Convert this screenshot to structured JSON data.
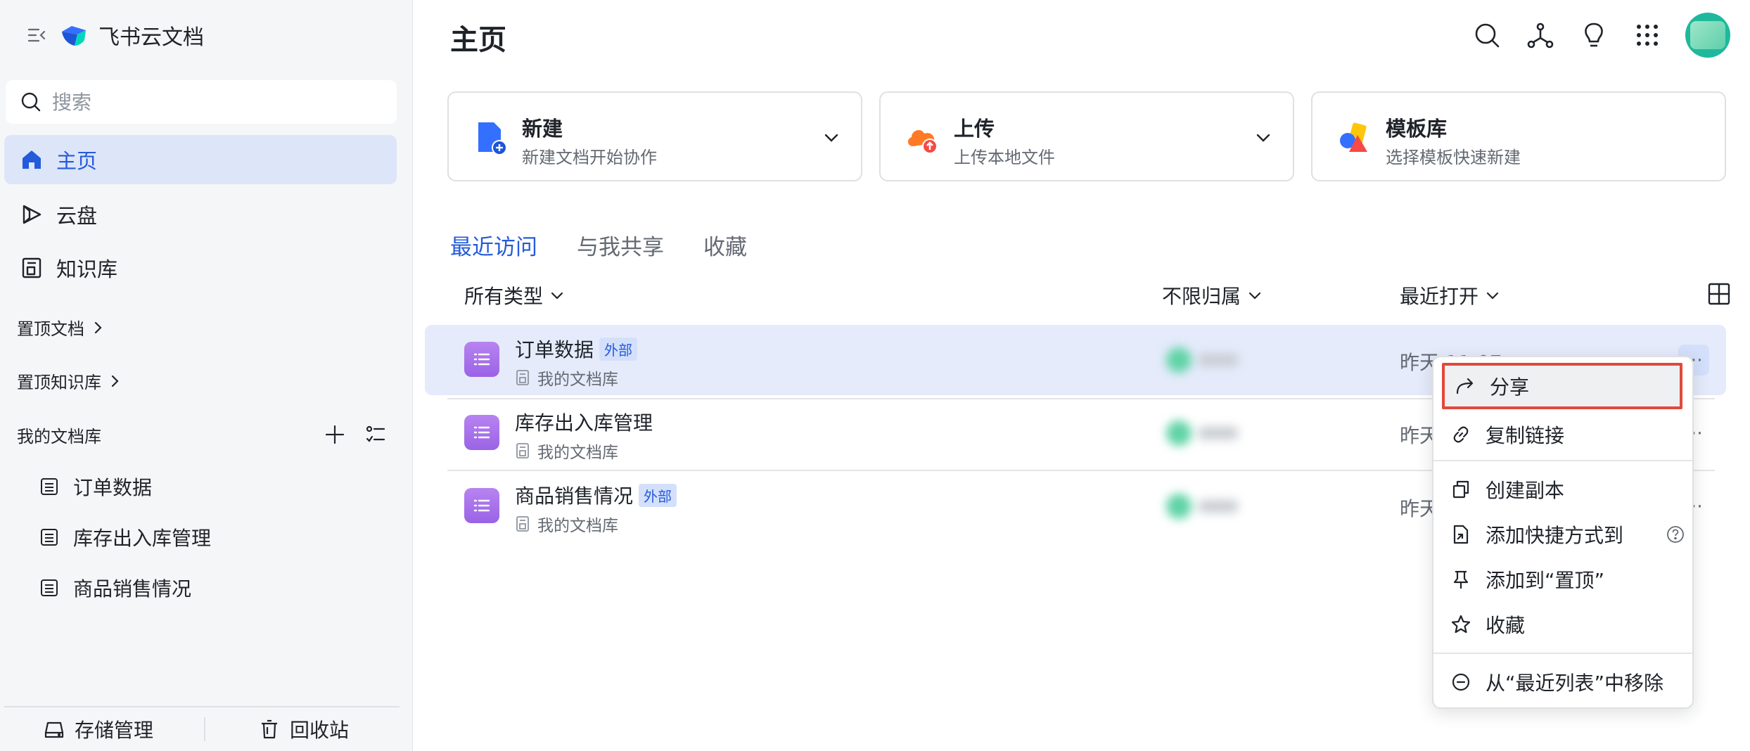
{
  "app": {
    "name": "飞书云文档"
  },
  "search": {
    "placeholder": "搜索"
  },
  "sidebar": {
    "nav": [
      {
        "label": "主页",
        "icon": "home-icon",
        "active": true
      },
      {
        "label": "云盘",
        "icon": "cloud-drive-icon",
        "active": false
      },
      {
        "label": "知识库",
        "icon": "wiki-icon",
        "active": false
      }
    ],
    "pinned_docs": "置顶文档",
    "pinned_wikis": "置顶知识库",
    "my_library": {
      "title": "我的文档库",
      "items": [
        "订单数据",
        "库存出入库管理",
        "商品销售情况"
      ]
    },
    "footer": {
      "storage": "存储管理",
      "trash": "回收站"
    }
  },
  "main": {
    "title": "主页",
    "cards": [
      {
        "title": "新建",
        "subtitle": "新建文档开始协作",
        "icon": "new-doc-icon"
      },
      {
        "title": "上传",
        "subtitle": "上传本地文件",
        "icon": "upload-cloud-icon"
      },
      {
        "title": "模板库",
        "subtitle": "选择模板快速新建",
        "icon": "template-library-icon"
      }
    ],
    "tabs": [
      "最近访问",
      "与我共享",
      "收藏"
    ],
    "active_tab": "最近访问",
    "filters": {
      "type": "所有类型",
      "owner": "不限归属",
      "sort": "最近打开"
    },
    "rows": [
      {
        "name": "订单数据",
        "badge": "外部",
        "library": "我的文档库",
        "time": "昨天 11:07"
      },
      {
        "name": "库存出入库管理",
        "badge": "",
        "library": "我的文档库",
        "time": "昨天"
      },
      {
        "name": "商品销售情况",
        "badge": "外部",
        "library": "我的文档库",
        "time": "昨天"
      }
    ]
  },
  "context_menu": {
    "items": [
      {
        "label": "分享",
        "icon": "share-icon"
      },
      {
        "label": "复制链接",
        "icon": "link-icon"
      },
      {
        "label": "创建副本",
        "icon": "copy-icon"
      },
      {
        "label": "添加快捷方式到",
        "icon": "shortcut-icon"
      },
      {
        "label": "添加到“置顶”",
        "icon": "pin-icon"
      },
      {
        "label": "收藏",
        "icon": "star-icon"
      },
      {
        "label": "从“最近列表”中移除",
        "icon": "remove-icon"
      }
    ],
    "highlighted": "分享"
  },
  "colors": {
    "accent": "#245bdb",
    "active_nav_bg": "#dde5f9",
    "row_hover_bg": "#e5ebfb",
    "doc_icon": "#9a63e6",
    "highlight_border": "#e0493b"
  }
}
